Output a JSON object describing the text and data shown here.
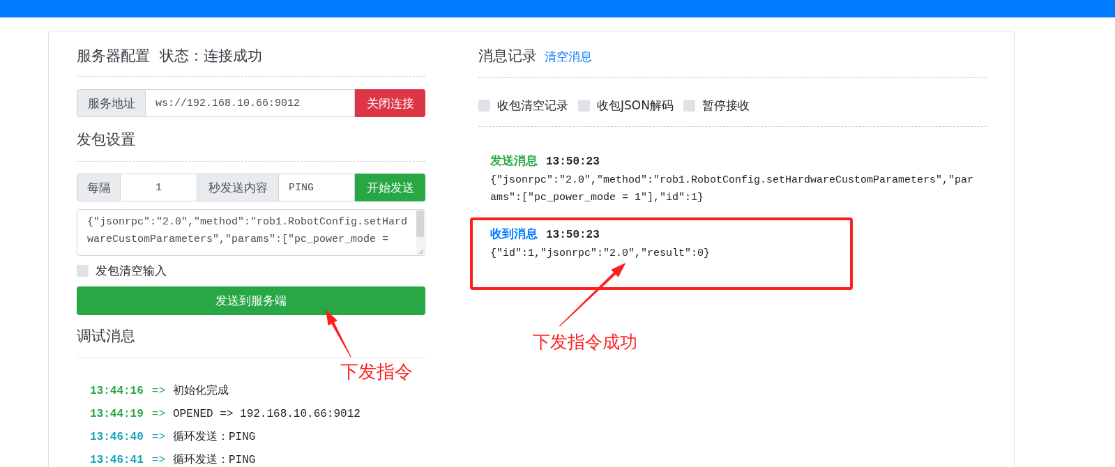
{
  "server_config": {
    "title": "服务器配置",
    "status": "状态：连接成功",
    "address_label": "服务地址",
    "address": "ws://192.168.10.66:9012",
    "close_button": "关闭连接"
  },
  "send_settings": {
    "title": "发包设置",
    "interval_label": "每隔",
    "interval": "1",
    "content_label": "秒发送内容",
    "content": "PING",
    "start_button": "开始发送",
    "payload": "{\"jsonrpc\":\"2.0\",\"method\":\"rob1.RobotConfig.setHardwareCustomParameters\",\"params\":[\"pc_power_mode =",
    "clear_input": {
      "label": "发包清空输入",
      "checked": false
    },
    "send_button": "发送到服务端"
  },
  "debug_log": {
    "title": "调试消息",
    "entries": [
      {
        "kind": "success",
        "time": "13:44:16",
        "arrow": "=>",
        "text": "初始化完成"
      },
      {
        "kind": "success",
        "time": "13:44:19",
        "arrow": "=>",
        "text": "OPENED => 192.168.10.66:9012"
      },
      {
        "kind": "info",
        "time": "13:46:40",
        "arrow": "=>",
        "text": "循环发送：PING"
      },
      {
        "kind": "info",
        "time": "13:46:41",
        "arrow": "=>",
        "text": "循环发送：PING"
      }
    ]
  },
  "message_log": {
    "title": "消息记录",
    "clear_link": "清空消息",
    "options": [
      {
        "label": "收包清空记录",
        "checked": false
      },
      {
        "label": "收包JSON解码",
        "checked": false
      },
      {
        "label": "暂停接收",
        "checked": false
      }
    ],
    "entries": [
      {
        "kind": "sent",
        "label": "发送消息",
        "time": "13:50:23",
        "body": "{\"jsonrpc\":\"2.0\",\"method\":\"rob1.RobotConfig.setHardwareCustomParameters\",\"params\":[\"pc_power_mode = 1\"],\"id\":1}",
        "highlighted": false
      },
      {
        "kind": "received",
        "label": "收到消息",
        "time": "13:50:23",
        "body": "{\"id\":1,\"jsonrpc\":\"2.0\",\"result\":0}",
        "highlighted": true
      }
    ]
  },
  "annotations": [
    {
      "text": "下发指令"
    },
    {
      "text": "下发指令成功"
    }
  ]
}
